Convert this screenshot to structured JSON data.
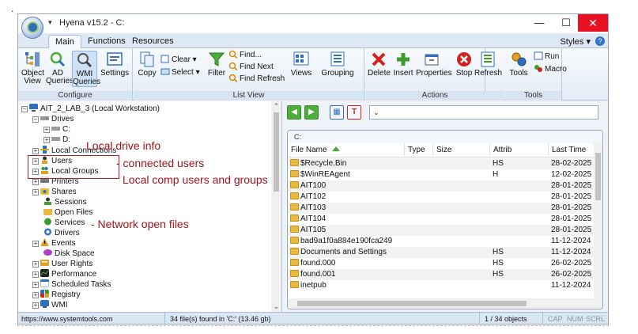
{
  "window": {
    "title": "Hyena v15.2 - C:",
    "qat_glyph": "▾",
    "minimize": "—",
    "maximize": "☐",
    "close": "✕"
  },
  "ribbon_tabs": [
    {
      "label": "Main"
    },
    {
      "label": "Functions"
    },
    {
      "label": "Resources"
    }
  ],
  "styles_menu": "Styles ▾",
  "groups": {
    "configure": {
      "caption": "Configure",
      "object_view": "Object View",
      "ad_queries": "AD Queries",
      "wmi_queries": "WMI Queries",
      "settings": "Settings"
    },
    "list_view": {
      "caption": "List View",
      "copy": "Copy",
      "clear": "Clear ▾",
      "select": "Select ▾",
      "filter": "Filter",
      "find": "Find...",
      "find_next": "Find Next",
      "find_refresh": "Find Refresh",
      "views": "Views",
      "grouping": "Grouping"
    },
    "actions": {
      "caption": "Actions",
      "delete": "Delete",
      "insert": "Insert",
      "properties": "Properties",
      "stop": "Stop",
      "refresh": "Refresh"
    },
    "tools": {
      "caption": "Tools",
      "tools": "Tools",
      "run": "Run",
      "macro": "Macro"
    }
  },
  "tree": {
    "root": "AIT_2_LAB_3 (Local Workstation)",
    "items": [
      {
        "label": "Drives"
      },
      {
        "label": "C:"
      },
      {
        "label": "D:"
      },
      {
        "label": "Local Connections"
      },
      {
        "label": "Users"
      },
      {
        "label": "Local Groups"
      },
      {
        "label": "Printers"
      },
      {
        "label": "Shares"
      },
      {
        "label": "Sessions"
      },
      {
        "label": "Open Files"
      },
      {
        "label": "Services"
      },
      {
        "label": "Drivers"
      },
      {
        "label": "Events"
      },
      {
        "label": "Disk Space"
      },
      {
        "label": "User Rights"
      },
      {
        "label": "Performance"
      },
      {
        "label": "Scheduled Tasks"
      },
      {
        "label": "Registry"
      },
      {
        "label": "WMI"
      }
    ]
  },
  "annotations": {
    "drive": "Local drive info",
    "connected": "- connected users",
    "users_groups": "Local comp users and groups",
    "open_files": "- Network open files"
  },
  "file_list": {
    "path": "C:",
    "columns": [
      "File Name",
      "Type",
      "Size",
      "Attrib",
      "Last Time"
    ],
    "rows": [
      {
        "name": "$Recycle.Bin",
        "type": "",
        "size": "",
        "attrib": "HS",
        "time": "28-02-2025"
      },
      {
        "name": "$WinREAgent",
        "type": "",
        "size": "",
        "attrib": "H",
        "time": "12-02-2025"
      },
      {
        "name": "AIT100",
        "type": "",
        "size": "",
        "attrib": "",
        "time": "28-01-2025"
      },
      {
        "name": "AIT102",
        "type": "",
        "size": "",
        "attrib": "",
        "time": "28-01-2025"
      },
      {
        "name": "AIT103",
        "type": "",
        "size": "",
        "attrib": "",
        "time": "28-01-2025"
      },
      {
        "name": "AIT104",
        "type": "",
        "size": "",
        "attrib": "",
        "time": "28-01-2025"
      },
      {
        "name": "AIT105",
        "type": "",
        "size": "",
        "attrib": "",
        "time": "28-01-2025"
      },
      {
        "name": "bad9a1f0a884e190fca249",
        "type": "",
        "size": "",
        "attrib": "",
        "time": "11-12-2024"
      },
      {
        "name": "Documents and Settings",
        "type": "",
        "size": "",
        "attrib": "HS",
        "time": "11-12-2024"
      },
      {
        "name": "found.000",
        "type": "",
        "size": "",
        "attrib": "HS",
        "time": "26-02-2025"
      },
      {
        "name": "found.001",
        "type": "",
        "size": "",
        "attrib": "HS",
        "time": "26-02-2025"
      },
      {
        "name": "inetpub",
        "type": "",
        "size": "",
        "attrib": "",
        "time": "11-12-2024"
      }
    ]
  },
  "status": {
    "url": "https://www.systemtools.com",
    "found": "34 file(s) found in 'C:'  (13.46 gb)",
    "objects": "1 / 34 objects",
    "cap": "CAP",
    "num": "NUM",
    "scrl": "SCRL"
  },
  "colors": {
    "accent_green": "#4fae3b",
    "annotation_red": "#a0141e",
    "close_red": "#e81123",
    "folder_yellow": "#e8b93c"
  }
}
